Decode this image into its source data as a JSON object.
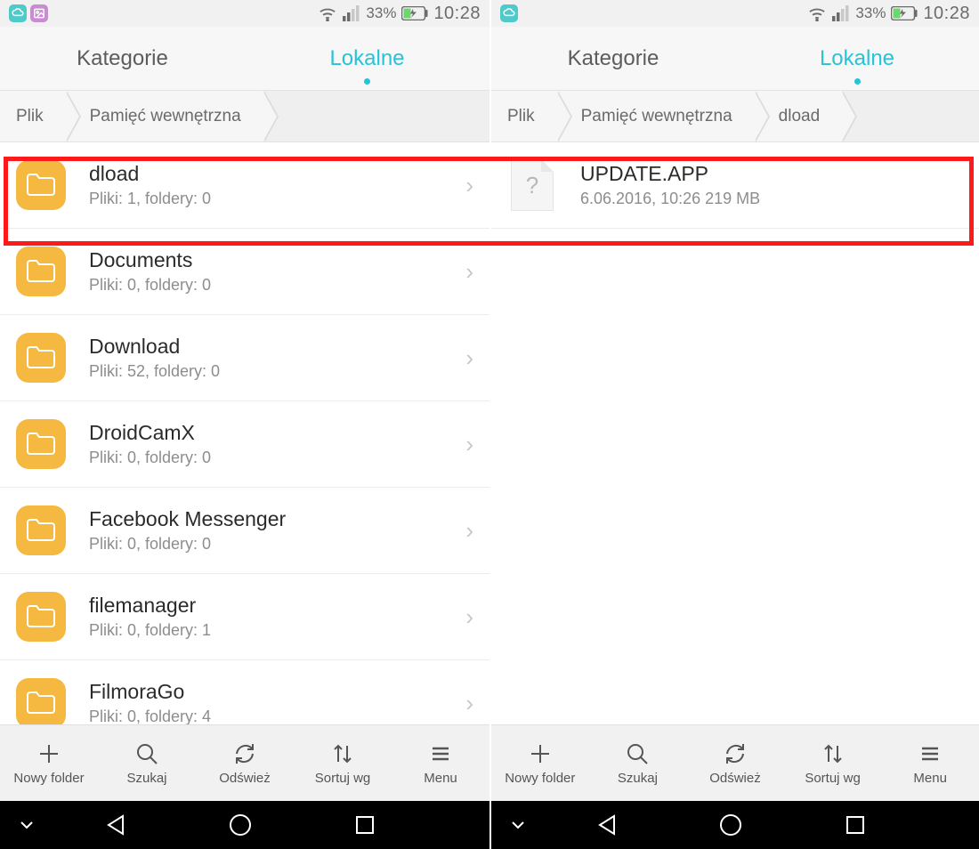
{
  "status": {
    "battery_pct": "33%",
    "time": "10:28"
  },
  "tabs": {
    "categories": "Kategorie",
    "local": "Lokalne"
  },
  "breadcrumb_left": [
    "Plik",
    "Pamięć wewnętrzna"
  ],
  "breadcrumb_right": [
    "Plik",
    "Pamięć wewnętrzna",
    "dload"
  ],
  "folders": [
    {
      "name": "dload",
      "sub": "Pliki: 1, foldery: 0"
    },
    {
      "name": "Documents",
      "sub": "Pliki: 0, foldery: 0"
    },
    {
      "name": "Download",
      "sub": "Pliki: 52, foldery: 0"
    },
    {
      "name": "DroidCamX",
      "sub": "Pliki: 0, foldery: 0"
    },
    {
      "name": "Facebook Messenger",
      "sub": "Pliki: 0, foldery: 0"
    },
    {
      "name": "filemanager",
      "sub": "Pliki: 0, foldery: 1"
    },
    {
      "name": "FilmoraGo",
      "sub": "Pliki: 0, foldery: 4"
    }
  ],
  "file": {
    "name": "UPDATE.APP",
    "sub": "6.06.2016, 10:26 219 MB"
  },
  "toolbar": {
    "new_folder": "Nowy folder",
    "search": "Szukaj",
    "refresh": "Odśwież",
    "sort": "Sortuj wg",
    "menu": "Menu"
  }
}
